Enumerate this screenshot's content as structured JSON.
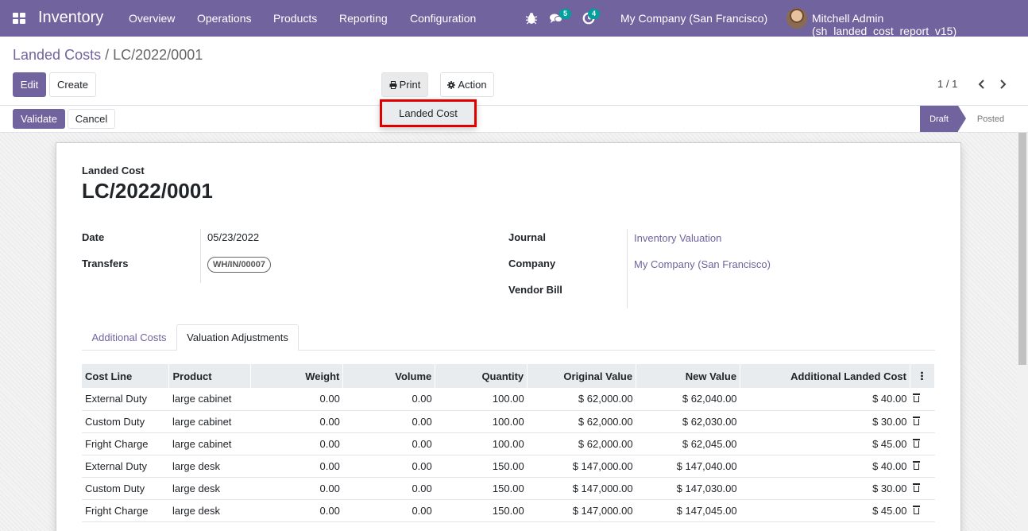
{
  "navbar": {
    "app_title": "Inventory",
    "menu": [
      "Overview",
      "Operations",
      "Products",
      "Reporting",
      "Configuration"
    ],
    "messages_count": "5",
    "activities_count": "4",
    "company": "My Company (San Francisco)",
    "user": "Mitchell Admin (sh_landed_cost_report_v15)"
  },
  "breadcrumb": {
    "parent": "Landed Costs",
    "separator": "/",
    "current": "LC/2022/0001"
  },
  "toolbar": {
    "edit": "Edit",
    "create": "Create",
    "print": "Print",
    "action": "Action",
    "pager": "1 / 1"
  },
  "print_menu": {
    "items": [
      "Landed Cost"
    ]
  },
  "statusbar": {
    "validate": "Validate",
    "cancel": "Cancel",
    "draft": "Draft",
    "posted": "Posted"
  },
  "form": {
    "label": "Landed Cost",
    "name": "LC/2022/0001",
    "date_label": "Date",
    "date": "05/23/2022",
    "transfers_label": "Transfers",
    "transfer_tag": "WH/IN/00007",
    "journal_label": "Journal",
    "journal": "Inventory Valuation",
    "company_label": "Company",
    "company": "My Company (San Francisco)",
    "vendor_bill_label": "Vendor Bill"
  },
  "tabs": [
    "Additional Costs",
    "Valuation Adjustments"
  ],
  "table": {
    "columns": [
      "Cost Line",
      "Product",
      "Weight",
      "Volume",
      "Quantity",
      "Original Value",
      "New Value",
      "Additional Landed Cost"
    ],
    "rows": [
      [
        "External Duty",
        "large cabinet",
        "0.00",
        "0.00",
        "100.00",
        "$ 62,000.00",
        "$ 62,040.00",
        "$ 40.00"
      ],
      [
        "Custom Duty",
        "large cabinet",
        "0.00",
        "0.00",
        "100.00",
        "$ 62,000.00",
        "$ 62,030.00",
        "$ 30.00"
      ],
      [
        "Fright Charge",
        "large cabinet",
        "0.00",
        "0.00",
        "100.00",
        "$ 62,000.00",
        "$ 62,045.00",
        "$ 45.00"
      ],
      [
        "External Duty",
        "large desk",
        "0.00",
        "0.00",
        "150.00",
        "$ 147,000.00",
        "$ 147,040.00",
        "$ 40.00"
      ],
      [
        "Custom Duty",
        "large desk",
        "0.00",
        "0.00",
        "150.00",
        "$ 147,000.00",
        "$ 147,030.00",
        "$ 30.00"
      ],
      [
        "Fright Charge",
        "large desk",
        "0.00",
        "0.00",
        "150.00",
        "$ 147,000.00",
        "$ 147,045.00",
        "$ 45.00"
      ]
    ]
  }
}
